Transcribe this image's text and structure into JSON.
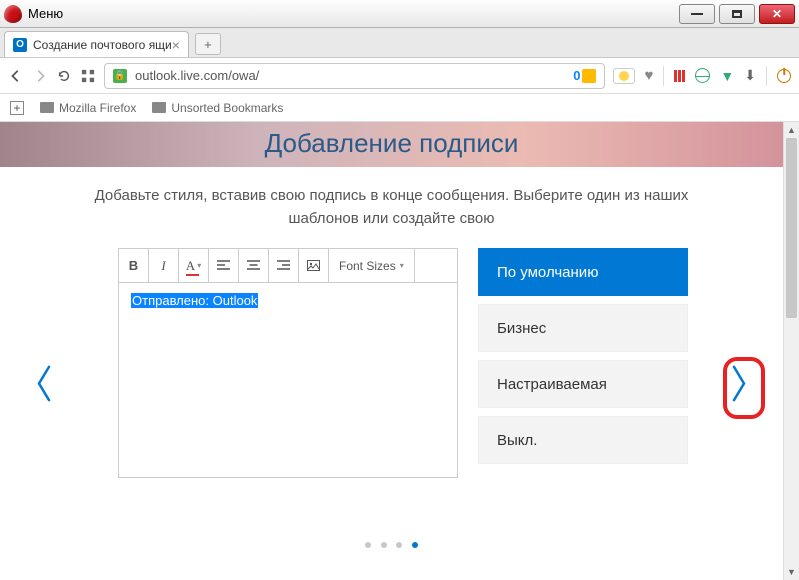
{
  "window": {
    "menu_label": "Меню"
  },
  "tab": {
    "title": "Создание почтового ящи",
    "favicon_letter": "O"
  },
  "address": {
    "url": "outlook.live.com/owa/",
    "badge_text": "0"
  },
  "bookmarks": {
    "folder1": "Mozilla Firefox",
    "folder2": "Unsorted Bookmarks"
  },
  "page": {
    "heading": "Добавление подписи",
    "subtitle": "Добавьте стиля, вставив свою подпись в конце сообщения. Выберите один из наших шаблонов или создайте свою"
  },
  "editor": {
    "font_sizes_label": "Font Sizes",
    "body_prefix": "Отправлено: ",
    "body_link": "Outlook"
  },
  "templates": {
    "items": [
      {
        "label": "По умолчанию",
        "active": true
      },
      {
        "label": "Бизнес",
        "active": false
      },
      {
        "label": "Настраиваемая",
        "active": false
      },
      {
        "label": "Выкл.",
        "active": false
      }
    ]
  },
  "pager": {
    "count": 4,
    "active_index": 3
  }
}
